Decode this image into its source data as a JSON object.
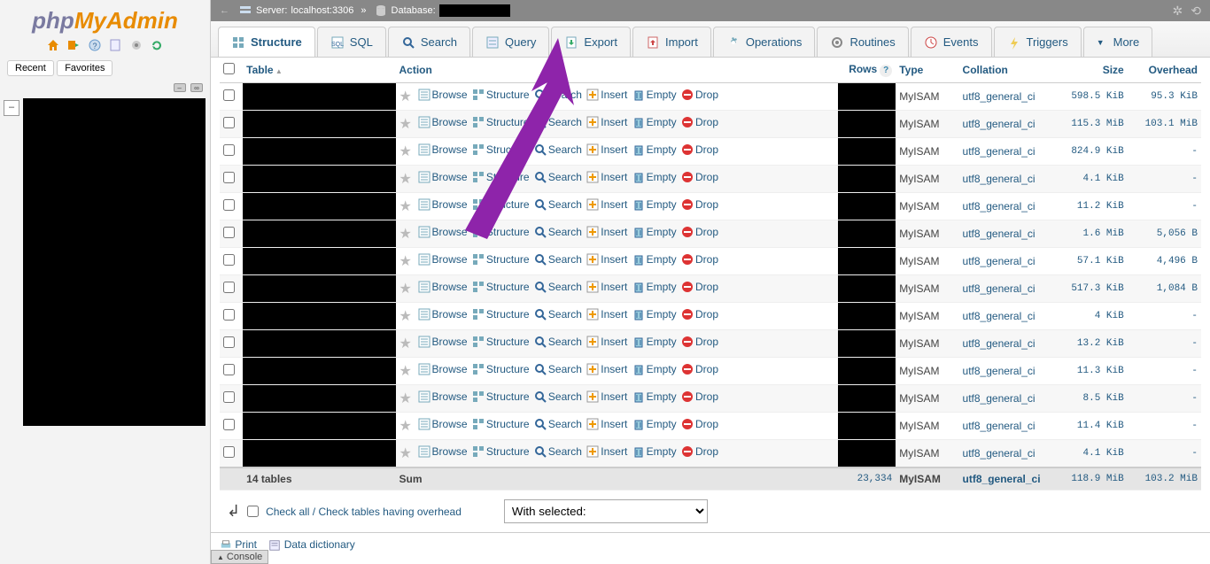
{
  "breadcrumb": {
    "server_label": "Server:",
    "server": "localhost:3306",
    "db_label": "Database:"
  },
  "tabs": [
    {
      "key": "structure",
      "label": "Structure",
      "active": true
    },
    {
      "key": "sql",
      "label": "SQL"
    },
    {
      "key": "search",
      "label": "Search"
    },
    {
      "key": "query",
      "label": "Query"
    },
    {
      "key": "export",
      "label": "Export"
    },
    {
      "key": "import",
      "label": "Import"
    },
    {
      "key": "operations",
      "label": "Operations"
    },
    {
      "key": "routines",
      "label": "Routines"
    },
    {
      "key": "events",
      "label": "Events"
    },
    {
      "key": "triggers",
      "label": "Triggers"
    },
    {
      "key": "more",
      "label": "More"
    }
  ],
  "headers": {
    "table": "Table",
    "action": "Action",
    "rows": "Rows",
    "type": "Type",
    "collation": "Collation",
    "size": "Size",
    "overhead": "Overhead"
  },
  "actions": {
    "browse": "Browse",
    "structure": "Structure",
    "search": "Search",
    "insert": "Insert",
    "empty": "Empty",
    "drop": "Drop"
  },
  "rows": [
    {
      "type": "MyISAM",
      "coll": "utf8_general_ci",
      "size": "598.5 KiB",
      "over": "95.3 KiB"
    },
    {
      "type": "MyISAM",
      "coll": "utf8_general_ci",
      "size": "115.3 MiB",
      "over": "103.1 MiB"
    },
    {
      "type": "MyISAM",
      "coll": "utf8_general_ci",
      "size": "824.9 KiB",
      "over": "-"
    },
    {
      "type": "MyISAM",
      "coll": "utf8_general_ci",
      "size": "4.1 KiB",
      "over": "-"
    },
    {
      "type": "MyISAM",
      "coll": "utf8_general_ci",
      "size": "11.2 KiB",
      "over": "-"
    },
    {
      "type": "MyISAM",
      "coll": "utf8_general_ci",
      "size": "1.6 MiB",
      "over": "5,056 B"
    },
    {
      "type": "MyISAM",
      "coll": "utf8_general_ci",
      "size": "57.1 KiB",
      "over": "4,496 B"
    },
    {
      "type": "MyISAM",
      "coll": "utf8_general_ci",
      "size": "517.3 KiB",
      "over": "1,084 B"
    },
    {
      "type": "MyISAM",
      "coll": "utf8_general_ci",
      "size": "4 KiB",
      "over": "-"
    },
    {
      "type": "MyISAM",
      "coll": "utf8_general_ci",
      "size": "13.2 KiB",
      "over": "-"
    },
    {
      "type": "MyISAM",
      "coll": "utf8_general_ci",
      "size": "11.3 KiB",
      "over": "-"
    },
    {
      "type": "MyISAM",
      "coll": "utf8_general_ci",
      "size": "8.5 KiB",
      "over": "-"
    },
    {
      "type": "MyISAM",
      "coll": "utf8_general_ci",
      "size": "11.4 KiB",
      "over": "-"
    },
    {
      "type": "MyISAM",
      "coll": "utf8_general_ci",
      "size": "4.1 KiB",
      "over": "-"
    }
  ],
  "sum": {
    "tables_label": "14 tables",
    "sum_label": "Sum",
    "rows": "23,334",
    "type": "MyISAM",
    "coll": "utf8_general_ci",
    "size": "118.9 MiB",
    "over": "103.2 MiB"
  },
  "checkall": {
    "label": "Check all / Check tables having overhead",
    "with_selected": "With selected:"
  },
  "footer": {
    "print": "Print",
    "dict": "Data dictionary"
  },
  "sidebar": {
    "recent": "Recent",
    "favorites": "Favorites"
  },
  "console": "Console"
}
